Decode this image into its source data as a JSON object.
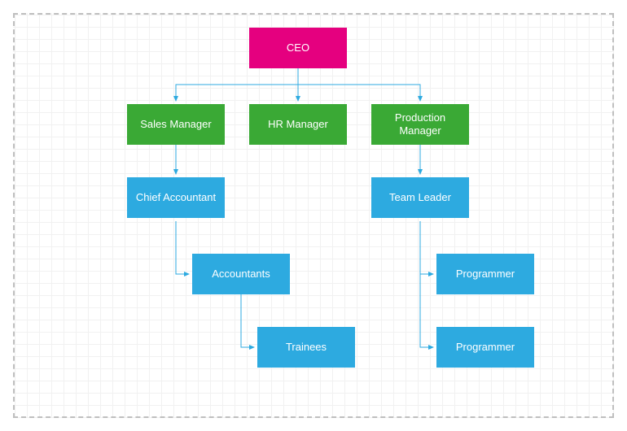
{
  "chart_data": {
    "type": "org-chart",
    "nodes": [
      {
        "id": "ceo",
        "label": "CEO",
        "color": "#e5007f",
        "level": 0,
        "parent": null
      },
      {
        "id": "sales",
        "label": "Sales Manager",
        "color": "#3aa935",
        "level": 1,
        "parent": "ceo"
      },
      {
        "id": "hr",
        "label": "HR Manager",
        "color": "#3aa935",
        "level": 1,
        "parent": "ceo"
      },
      {
        "id": "prod",
        "label": "Production Manager",
        "color": "#3aa935",
        "level": 1,
        "parent": "ceo"
      },
      {
        "id": "chief",
        "label": "Chief Accountant",
        "color": "#2daae0",
        "level": 2,
        "parent": "sales"
      },
      {
        "id": "team",
        "label": "Team Leader",
        "color": "#2daae0",
        "level": 2,
        "parent": "prod"
      },
      {
        "id": "acc",
        "label": "Accountants",
        "color": "#2daae0",
        "level": 3,
        "parent": "chief"
      },
      {
        "id": "prog1",
        "label": "Programmer",
        "color": "#2daae0",
        "level": 3,
        "parent": "team"
      },
      {
        "id": "train",
        "label": "Trainees",
        "color": "#2daae0",
        "level": 4,
        "parent": "acc"
      },
      {
        "id": "prog2",
        "label": "Programmer",
        "color": "#2daae0",
        "level": 4,
        "parent": "team"
      }
    ],
    "connector_color": "#2daae0"
  },
  "nodes": {
    "ceo": "CEO",
    "sales": "Sales Manager",
    "hr": "HR Manager",
    "prod": "Production Manager",
    "chief": "Chief Accountant",
    "team": "Team Leader",
    "acc": "Accountants",
    "prog1": "Programmer",
    "train": "Trainees",
    "prog2": "Programmer"
  }
}
